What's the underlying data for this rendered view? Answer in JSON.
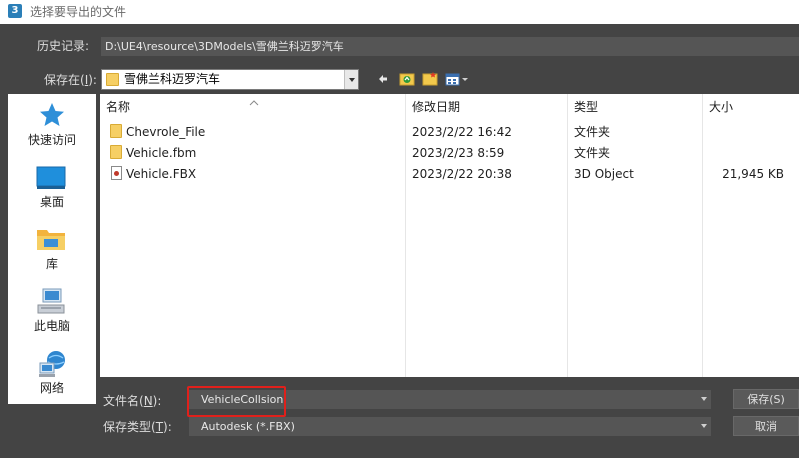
{
  "window": {
    "app_icon_text": "3",
    "title": "选择要导出的文件"
  },
  "history": {
    "label": "历史记录:",
    "path": "D:\\UE4\\resource\\3DModels\\雪佛兰科迈罗汽车"
  },
  "save_in": {
    "label_prefix": "保存在(",
    "label_key": "I",
    "label_suffix": "):",
    "value": "雪佛兰科迈罗汽车"
  },
  "places": [
    {
      "label": "快速访问",
      "icon": "star-icon"
    },
    {
      "label": "桌面",
      "icon": "desktop-icon"
    },
    {
      "label": "库",
      "icon": "library-icon"
    },
    {
      "label": "此电脑",
      "icon": "computer-icon"
    },
    {
      "label": "网络",
      "icon": "network-icon"
    }
  ],
  "columns": {
    "name": "名称",
    "modified": "修改日期",
    "type": "类型",
    "size": "大小"
  },
  "files": [
    {
      "name": "Chevrole_File",
      "modified": "2023/2/22 16:42",
      "type": "文件夹",
      "size": "",
      "icon": "folder-icon"
    },
    {
      "name": "Vehicle.fbm",
      "modified": "2023/2/23 8:59",
      "type": "文件夹",
      "size": "",
      "icon": "folder-icon"
    },
    {
      "name": "Vehicle.FBX",
      "modified": "2023/2/22 20:38",
      "type": "3D Object",
      "size": "21,945 KB",
      "icon": "fbx-file-icon"
    }
  ],
  "filename": {
    "label_prefix": "文件名(",
    "label_key": "N",
    "label_suffix": "):",
    "value": "VehicleCollsion"
  },
  "filetype": {
    "label_prefix": "保存类型(",
    "label_key": "T",
    "label_suffix": "):",
    "value": "Autodesk (*.FBX)"
  },
  "buttons": {
    "save": "保存(S)",
    "cancel": "取消"
  },
  "colors": {
    "dialog_bg": "#444444",
    "highlight": "#e0201b",
    "folder": "#f6cf64"
  }
}
